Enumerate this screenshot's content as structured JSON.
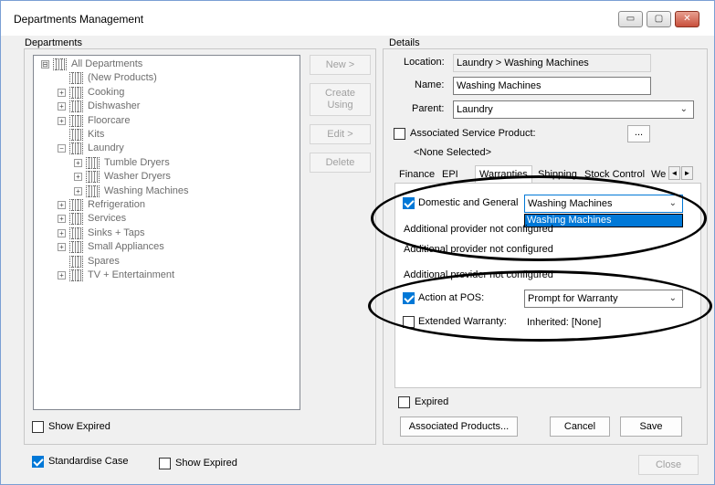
{
  "window": {
    "title": "Departments Management",
    "controls": {
      "minimize": "▭",
      "maximize": "▢",
      "close": "✕"
    }
  },
  "departments": {
    "group_label": "Departments",
    "tree": [
      {
        "label": "All Departments",
        "level": 0,
        "expander": "⊟"
      },
      {
        "label": "(New Products)",
        "level": 1,
        "expander": ""
      },
      {
        "label": "Cooking",
        "level": 1,
        "expander": "+"
      },
      {
        "label": "Dishwasher",
        "level": 1,
        "expander": "+"
      },
      {
        "label": "Floorcare",
        "level": 1,
        "expander": "+"
      },
      {
        "label": "Kits",
        "level": 1,
        "expander": ""
      },
      {
        "label": "Laundry",
        "level": 1,
        "expander": "−"
      },
      {
        "label": "Tumble Dryers",
        "level": 2,
        "expander": "+"
      },
      {
        "label": "Washer Dryers",
        "level": 2,
        "expander": "+"
      },
      {
        "label": "Washing Machines",
        "level": 2,
        "expander": "+"
      },
      {
        "label": "Refrigeration",
        "level": 1,
        "expander": "+"
      },
      {
        "label": "Services",
        "level": 1,
        "expander": "+"
      },
      {
        "label": "Sinks + Taps",
        "level": 1,
        "expander": "+"
      },
      {
        "label": "Small Appliances",
        "level": 1,
        "expander": "+"
      },
      {
        "label": "Spares",
        "level": 1,
        "expander": ""
      },
      {
        "label": "TV + Entertainment",
        "level": 1,
        "expander": "+"
      }
    ],
    "show_expired_label": "Show Expired",
    "show_expired_checked": false
  },
  "actions": {
    "new_label": "New >",
    "create_using_line1": "Create",
    "create_using_line2": "Using",
    "edit_label": "Edit >",
    "delete_label": "Delete"
  },
  "details": {
    "group_label": "Details",
    "location_label": "Location:",
    "location_value": "Laundry > Washing Machines",
    "name_label": "Name:",
    "name_value": "Washing Machines",
    "parent_label": "Parent:",
    "parent_value": "Laundry",
    "assoc_service_label": "Associated Service Product:",
    "assoc_service_checked": false,
    "assoc_browse_label": "...",
    "none_selected": "<None Selected>",
    "tabs": [
      "Finance",
      "EPI",
      "Warranties",
      "Shipping",
      "Stock Control",
      "We"
    ],
    "active_tab": "Warranties",
    "tab_prev": "◄",
    "tab_next": "►",
    "warranties": {
      "domestic_label": "Domestic and General",
      "domestic_checked": true,
      "domestic_value": "Washing Machines",
      "dropdown_option": "Washing Machines",
      "provider_msg_1": "Additional provider not configured",
      "provider_msg_2": "Additional provider not configured",
      "provider_msg_3": "Additional provider not configured",
      "action_pos_label": "Action at POS:",
      "action_pos_checked": true,
      "action_pos_value": "Prompt for Warranty",
      "extended_label": "Extended Warranty:",
      "extended_checked": false,
      "extended_value": "Inherited: [None]"
    },
    "expired_label": "Expired",
    "expired_checked": false,
    "associated_products_label": "Associated Products...",
    "cancel_label": "Cancel",
    "save_label": "Save"
  },
  "footer": {
    "standardise_label": "Standardise Case",
    "standardise_checked": true,
    "show_expired_label": "Show Expired",
    "show_expired_checked": false,
    "close_label": "Close"
  },
  "icons": {
    "combo_arrow": "⌄"
  }
}
